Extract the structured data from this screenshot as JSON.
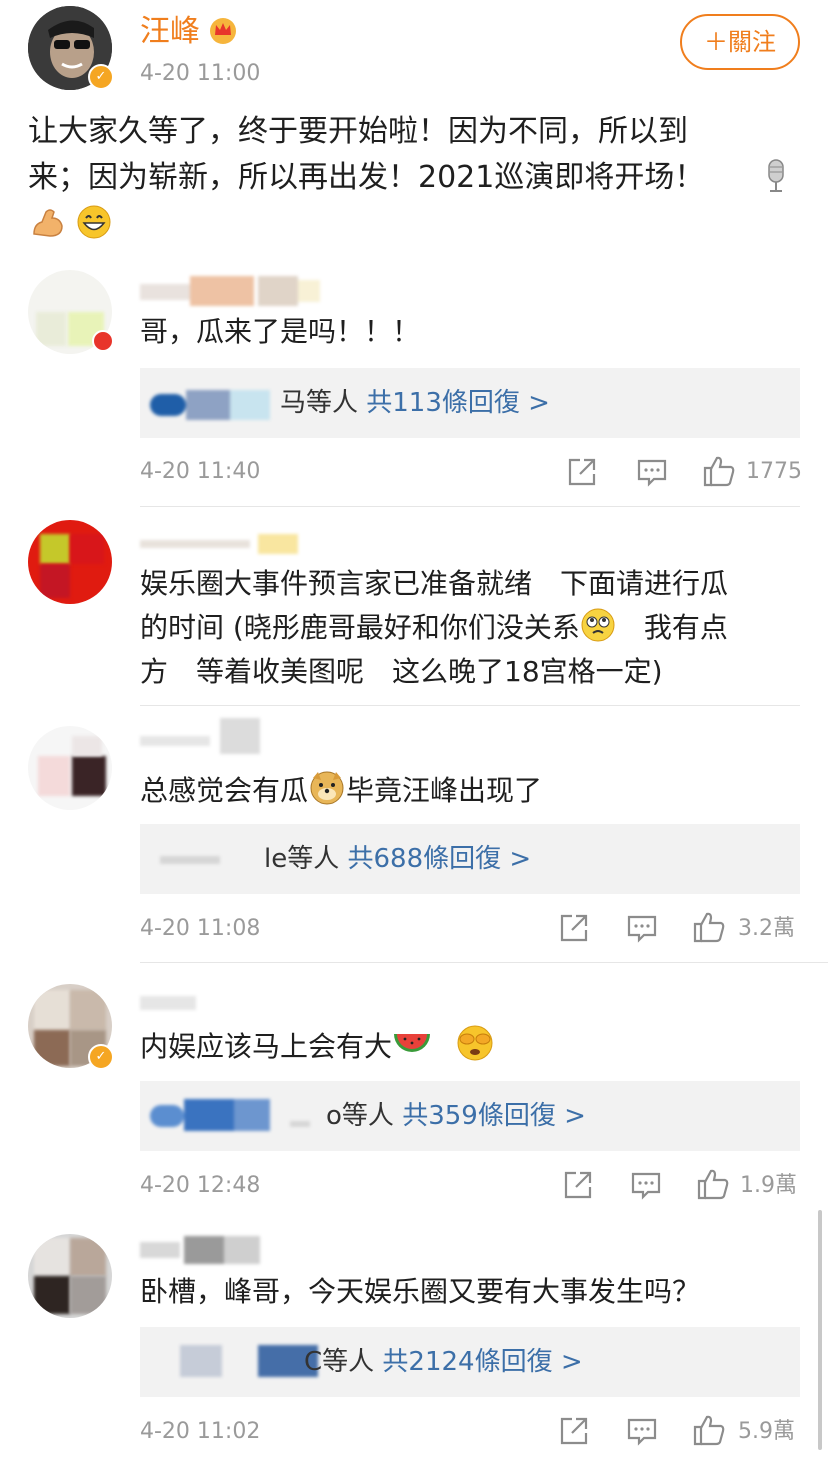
{
  "post": {
    "author": "汪峰",
    "time": "4-20 11:00",
    "follow_label": "＋關注",
    "text_line1": "让大家久等了，终于要开始啦！因为不同，所以到",
    "text_line2": "来；因为崭新，所以再出发！2021巡演即将开场！"
  },
  "comments": [
    {
      "text": "哥，瓜来了是吗！！！",
      "reply_suffix": "马等人 ",
      "reply_link": "共113條回復 >",
      "time": "4-20 11:40",
      "likes": "1775"
    },
    {
      "text_line1": "娱乐圈大事件预言家已准备就绪　下面请进行瓜",
      "text_line2a": "的时间 (晓彤鹿哥最好和你们没关系",
      "text_line2b": "　我有点",
      "text_line3": "方　等着收美图呢　这么晚了18宫格一定)"
    },
    {
      "text_a": "总感觉会有瓜",
      "text_b": "毕竟汪峰出现了",
      "reply_suffix": "le等人 ",
      "reply_link": "共688條回復 >",
      "time": "4-20 11:08",
      "likes": "3.2萬"
    },
    {
      "text": "内娱应该马上会有大",
      "reply_suffix": "o等人 ",
      "reply_link": "共359條回復 >",
      "time": "4-20 12:48",
      "likes": "1.9萬"
    },
    {
      "text": "卧槽，峰哥，今天娱乐圈又要有大事发生吗？",
      "reply_suffix": "C等人 ",
      "reply_link": "共2124條回復 >",
      "time": "4-20 11:02",
      "likes": "5.9萬"
    }
  ],
  "icons": {
    "share": "share-icon",
    "comment": "comment-icon",
    "like": "thumbs-up-icon"
  },
  "colors": {
    "author_name": "#f07e1d",
    "follow_border": "#f07e1d",
    "reply_link": "#3c6fa8",
    "verified_badge": "#f5a623"
  }
}
